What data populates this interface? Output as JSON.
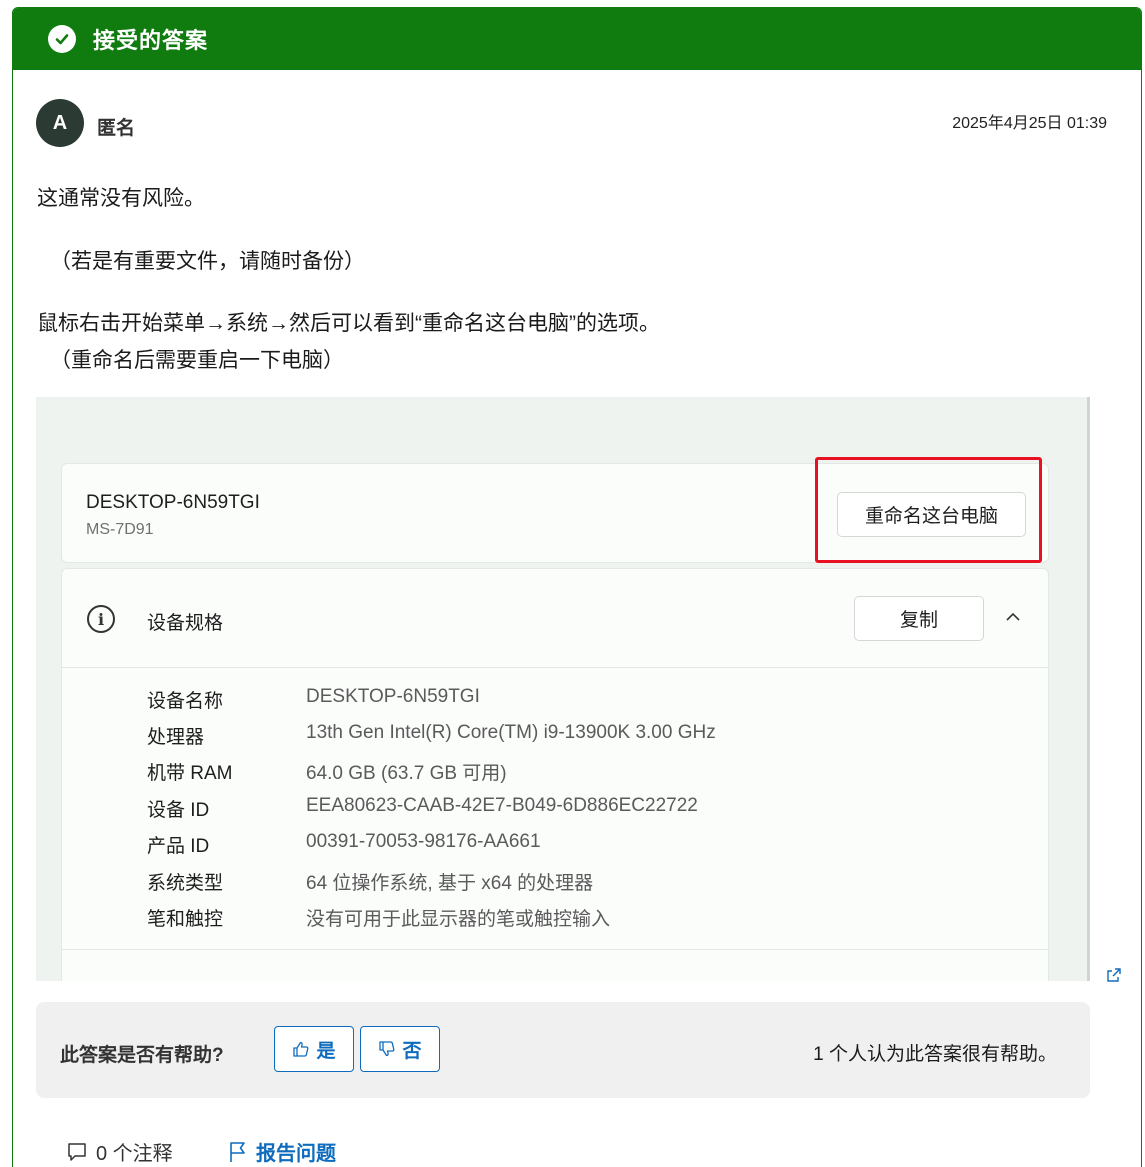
{
  "header": {
    "title": "接受的答案"
  },
  "author": {
    "avatar_letter": "A",
    "name": "匿名",
    "timestamp": "2025年4月25日 01:39"
  },
  "body": {
    "paragraphs": [
      "这通常没有风险。",
      "（若是有重要文件，请随时备份）",
      "鼠标右击开始菜单→系统→然后可以看到“重命名这台电脑”的选项。",
      "（重命名后需要重启一下电脑）"
    ]
  },
  "screenshot": {
    "device_name": "DESKTOP-6N59TGI",
    "device_model": "MS-7D91",
    "rename_button": "重命名这台电脑",
    "spec_title": "设备规格",
    "copy_button": "复制",
    "specs": [
      {
        "label": "设备名称",
        "value": "DESKTOP-6N59TGI"
      },
      {
        "label": "处理器",
        "value": "13th Gen Intel(R) Core(TM) i9-13900K   3.00 GHz"
      },
      {
        "label": "机带 RAM",
        "value": "64.0 GB (63.7 GB 可用)"
      },
      {
        "label": "设备 ID",
        "value": "EEA80623-CAAB-42E7-B049-6D886EC22722"
      },
      {
        "label": "产品 ID",
        "value": "00391-70053-98176-AA661"
      },
      {
        "label": "系统类型",
        "value": "64 位操作系统, 基于 x64 的处理器"
      },
      {
        "label": "笔和触控",
        "value": "没有可用于此显示器的笔或触控输入"
      }
    ],
    "highlight_color": "#e81123"
  },
  "feedback": {
    "question": "此答案是否有帮助?",
    "yes_label": "是",
    "no_label": "否",
    "helpful_count_text": "1 个人认为此答案很有帮助。"
  },
  "footer": {
    "comments_label": "0 个注释",
    "report_label": "报告问题"
  },
  "colors": {
    "accent_green": "#107c10",
    "link_blue": "#0f6cbd"
  }
}
